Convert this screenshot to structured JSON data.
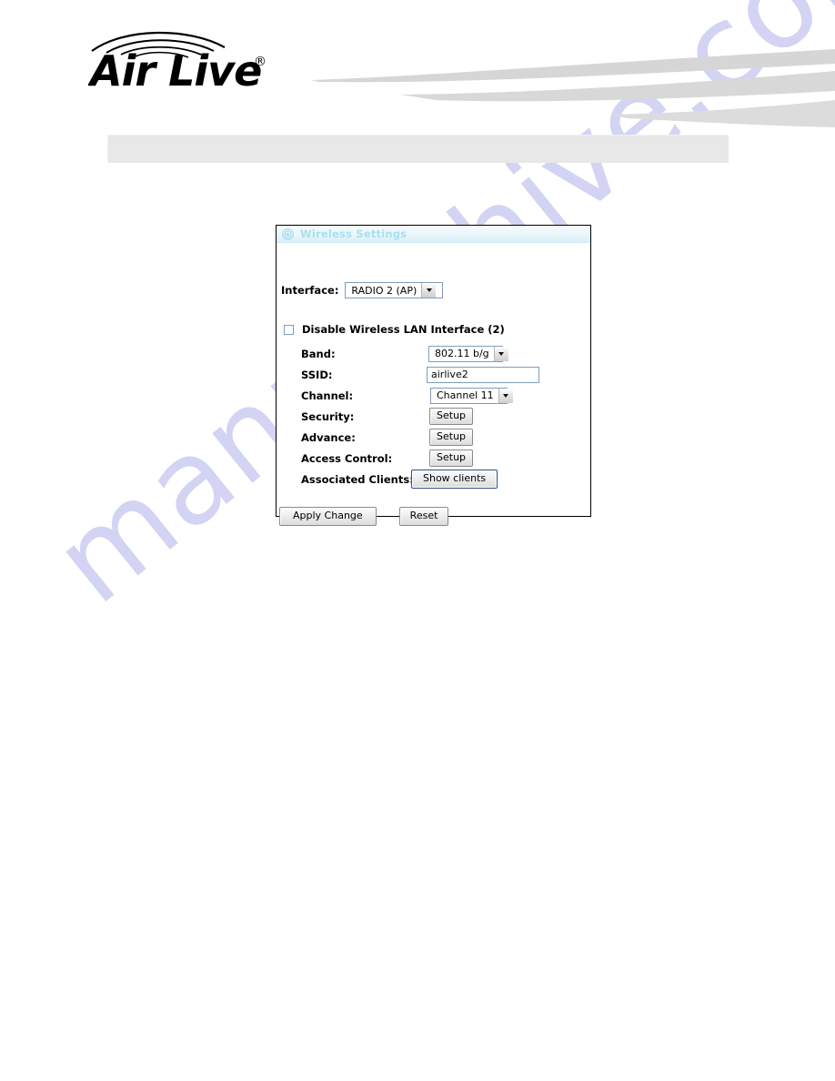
{
  "brand": {
    "logo_text": "Air Live",
    "logo_trademark": "®",
    "logo_name": "airlive-logo"
  },
  "header": {
    "banner_name": "decorative-swoosh-banner",
    "gray_bar_name": "header-gray-bar"
  },
  "watermark": {
    "text": "manualshive.com",
    "color": "#ccccf2"
  },
  "dialog": {
    "title": "Wireless Settings",
    "title_icon": "target-circle-icon",
    "title_color": "#aadeee",
    "interface": {
      "label": "Interface:",
      "value": "RADIO 2 (AP)",
      "options": [
        "RADIO 2 (AP)"
      ]
    },
    "disable_checkbox": {
      "label": "Disable Wireless LAN Interface (2)",
      "checked": false
    },
    "fields": [
      {
        "label": "Band:",
        "type": "select",
        "value": "802.11 b/g"
      },
      {
        "label": "SSID:",
        "type": "text",
        "value": "airlive2"
      },
      {
        "label": "Channel:",
        "type": "select",
        "value": "Channel 11"
      },
      {
        "label": "Security:",
        "type": "button",
        "value": "Setup"
      },
      {
        "label": "Advance:",
        "type": "button",
        "value": "Setup"
      },
      {
        "label": "Access Control:",
        "type": "button",
        "value": "Setup"
      },
      {
        "label": "Associated Clients:",
        "type": "button-focus",
        "value": "Show clients"
      }
    ],
    "actions": {
      "apply_label": "Apply Change",
      "reset_label": "Reset"
    }
  }
}
